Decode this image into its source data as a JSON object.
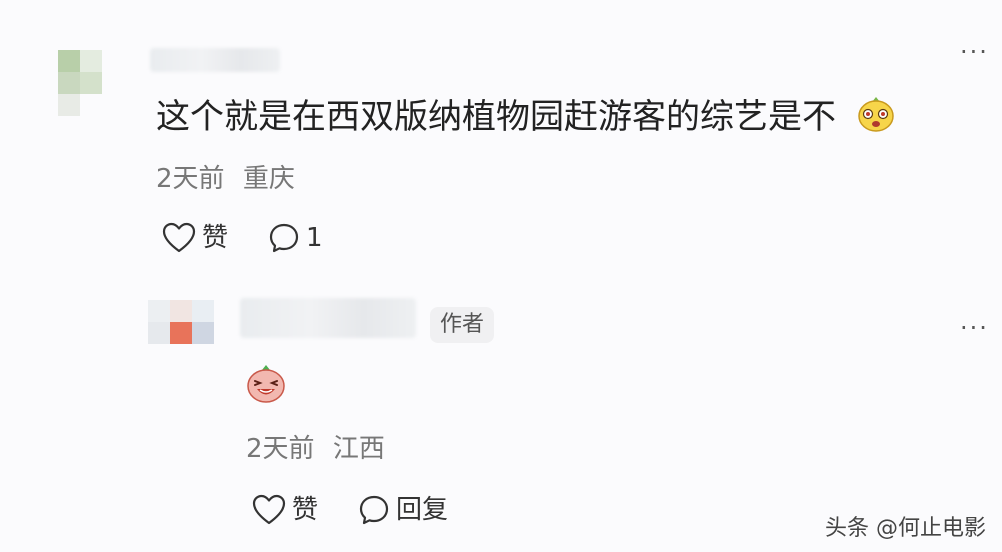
{
  "comment": {
    "text": "这个就是在西双版纳植物园赶游客的综艺是不",
    "emoji_icon": "grimace-face-icon",
    "time": "2天前",
    "location": "重庆",
    "like_label": "赞",
    "reply_count": "1"
  },
  "reply": {
    "author_badge": "作者",
    "emoji_icon": "laughing-face-icon",
    "time": "2天前",
    "location": "江西",
    "like_label": "赞",
    "reply_label": "回复"
  },
  "watermark": "头条 @何止电影",
  "colors": {
    "text": "#222222",
    "meta": "#777777",
    "background": "#fbfbfd",
    "badge_bg": "#f0f0f2"
  }
}
